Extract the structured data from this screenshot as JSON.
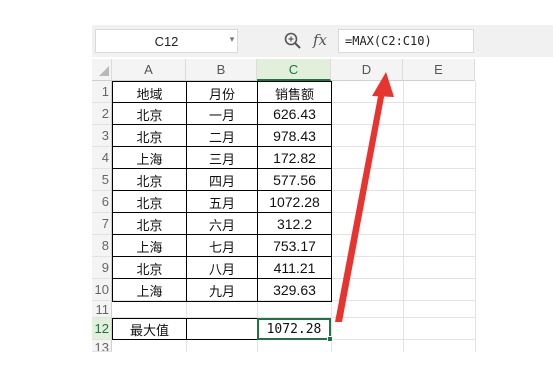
{
  "formula_bar": {
    "name_box": "C12",
    "formula": "=MAX(C2:C10)",
    "fx_label": "fx",
    "zoom_icon": "zoom-formula-icon",
    "dropdown_icon": "chevron-down-icon"
  },
  "columns": [
    "A",
    "B",
    "C",
    "D",
    "E"
  ],
  "selected_column": "C",
  "rows": [
    "1",
    "2",
    "3",
    "4",
    "5",
    "6",
    "7",
    "8",
    "9",
    "10",
    "11",
    "12",
    "13"
  ],
  "selected_row": "12",
  "table": {
    "headers": [
      "地域",
      "月份",
      "销售额"
    ],
    "data": [
      [
        "北京",
        "一月",
        "626.43"
      ],
      [
        "北京",
        "二月",
        "978.43"
      ],
      [
        "上海",
        "三月",
        "172.82"
      ],
      [
        "北京",
        "四月",
        "577.56"
      ],
      [
        "北京",
        "五月",
        "1072.28"
      ],
      [
        "北京",
        "六月",
        "312.2"
      ],
      [
        "上海",
        "七月",
        "753.17"
      ],
      [
        "北京",
        "八月",
        "411.21"
      ],
      [
        "上海",
        "九月",
        "329.63"
      ]
    ]
  },
  "summary": {
    "label": "最大值",
    "result": "1072.28"
  },
  "colors": {
    "selection": "#217346",
    "arrow": "#e8342f",
    "header_bg": "#f4f4f4"
  }
}
